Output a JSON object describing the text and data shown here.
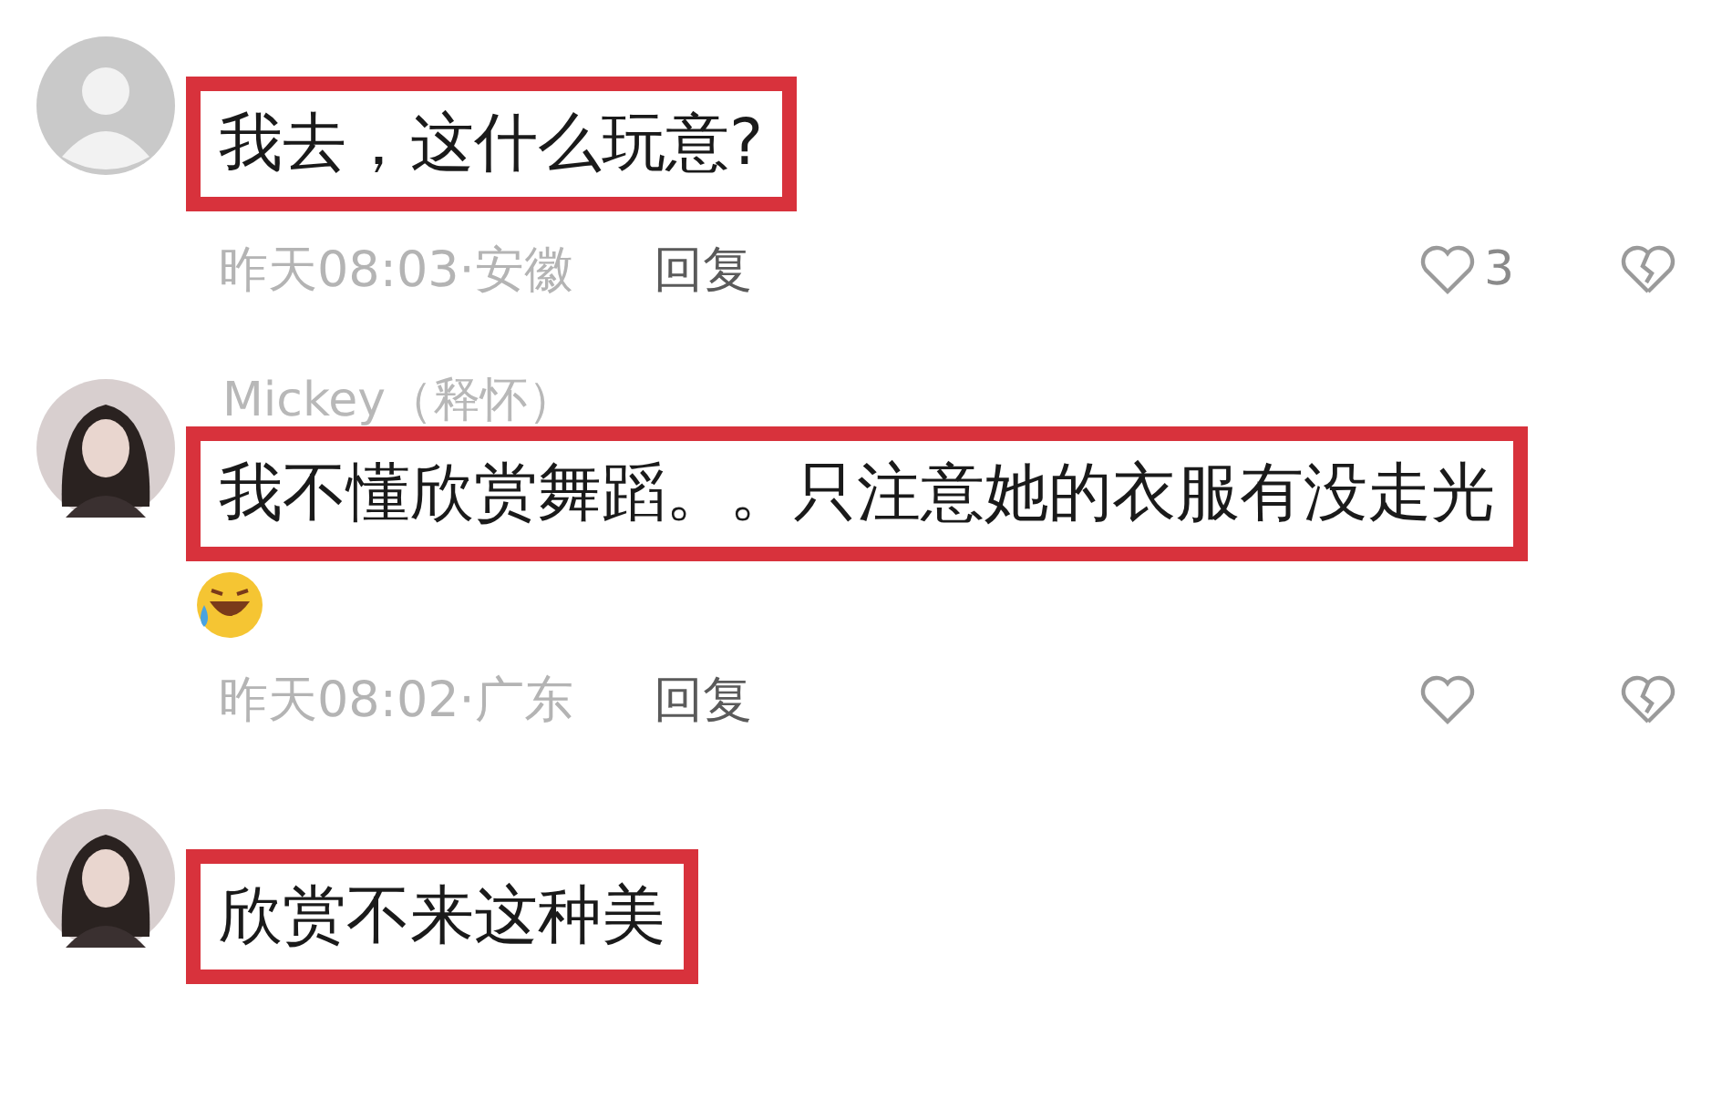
{
  "comments": [
    {
      "avatar_photo": false,
      "text": "我去，这什么玩意?",
      "has_emoji": false,
      "time": "昨天08:03·安徽",
      "reply": "回复",
      "likes": "3"
    },
    {
      "avatar_photo": true,
      "name": "Mickey（释怀）",
      "text": "我不懂欣赏舞蹈。。只注意她的衣服有没走光",
      "has_emoji": true,
      "time": "昨天08:02·广东",
      "reply": "回复"
    },
    {
      "avatar_photo": true,
      "text": "欣赏不来这种美",
      "has_emoji": false
    }
  ]
}
